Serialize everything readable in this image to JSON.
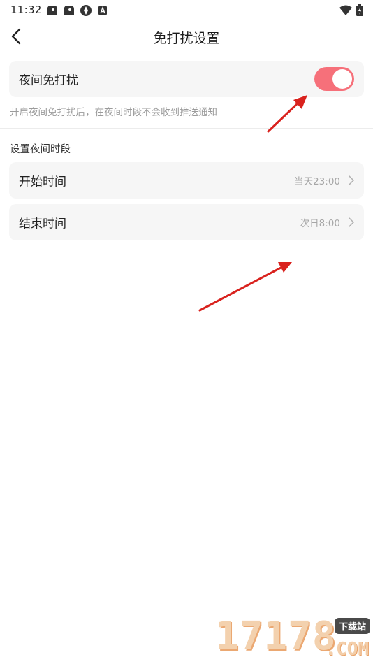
{
  "status_bar": {
    "time": "11:32",
    "left_icons": [
      "notification-app-icon",
      "notification-app-icon",
      "notification-app-icon",
      "notification-app-icon"
    ],
    "right_icons": [
      "wifi-icon",
      "battery-charging-icon"
    ]
  },
  "header": {
    "title": "免打扰设置",
    "back_icon": "chevron-left-icon"
  },
  "night_dnd": {
    "label": "夜间免打扰",
    "enabled": true,
    "hint": "开启夜间免打扰后，在夜间时段不会收到推送通知"
  },
  "section": {
    "title": "设置夜间时段"
  },
  "time_items": [
    {
      "label": "开始时间",
      "value": "当天23:00"
    },
    {
      "label": "结束时间",
      "value": "次日8:00"
    }
  ],
  "watermark": {
    "digits": "17178",
    "badge": "下载站",
    "suffix": ".COM"
  },
  "colors": {
    "toggle_on": "#f6707a",
    "card_bg": "#f6f6f6",
    "annotation_arrow": "#d9221e"
  }
}
